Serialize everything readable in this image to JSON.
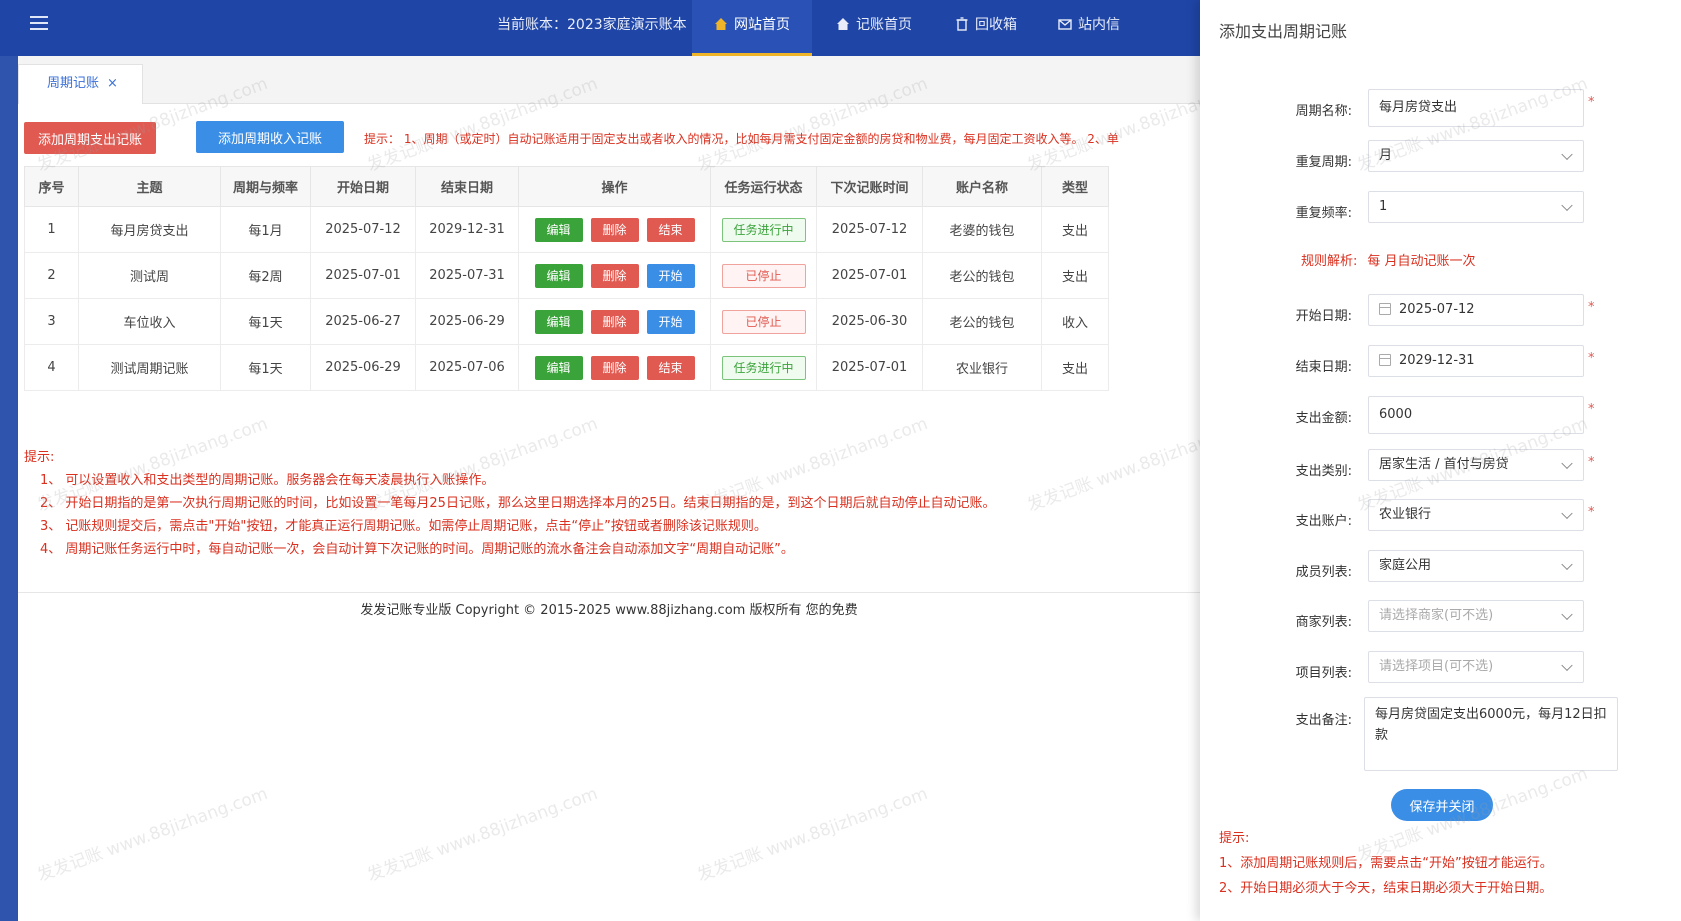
{
  "header": {
    "current_account": "当前账本：2023家庭演示账本",
    "nav": [
      {
        "label": "网站首页",
        "active": true
      },
      {
        "label": "记账首页",
        "active": false
      },
      {
        "label": "回收箱",
        "active": false
      },
      {
        "label": "站内信",
        "active": false
      }
    ]
  },
  "tab": {
    "label": "周期记账",
    "close": "×"
  },
  "toolbar": {
    "add_expense": "添加周期支出记账",
    "add_income": "添加周期收入记账",
    "tip": "提示：  1、周期（或定时）自动记账适用于固定支出或者收入的情况，比如每月需支付固定金额的房贷和物业费，每月固定工资收入等。   2、单"
  },
  "table": {
    "columns": [
      "序号",
      "主题",
      "周期与频率",
      "开始日期",
      "结束日期",
      "操作",
      "任务运行状态",
      "下次记账时间",
      "账户名称",
      "类型"
    ],
    "rows": [
      {
        "no": "1",
        "subject": "每月房贷支出",
        "freq": "每1月",
        "start": "2025-07-12",
        "end": "2029-12-31",
        "ops": [
          "编辑",
          "删除",
          "结束"
        ],
        "status": "任务进行中",
        "next": "2025-07-12",
        "account": "老婆的钱包",
        "type": "支出"
      },
      {
        "no": "2",
        "subject": "测试周",
        "freq": "每2周",
        "start": "2025-07-01",
        "end": "2025-07-31",
        "ops": [
          "编辑",
          "删除",
          "开始"
        ],
        "status": "已停止",
        "next": "2025-07-01",
        "account": "老公的钱包",
        "type": "支出"
      },
      {
        "no": "3",
        "subject": "车位收入",
        "freq": "每1天",
        "start": "2025-06-27",
        "end": "2025-06-29",
        "ops": [
          "编辑",
          "删除",
          "开始"
        ],
        "status": "已停止",
        "next": "2025-06-30",
        "account": "老公的钱包",
        "type": "收入"
      },
      {
        "no": "4",
        "subject": "测试周期记账",
        "freq": "每1天",
        "start": "2025-06-29",
        "end": "2025-07-06",
        "ops": [
          "编辑",
          "删除",
          "结束"
        ],
        "status": "任务进行中",
        "next": "2025-07-01",
        "account": "农业银行",
        "type": "支出"
      }
    ]
  },
  "notes": {
    "title": "提示:",
    "items": [
      "1、  可以设置收入和支出类型的周期记账。服务器会在每天凌晨执行入账操作。",
      "2、  开始日期指的是第一次执行周期记账的时间，比如设置一笔每月25日记账，那么这里日期选择本月的25日。结束日期指的是，到这个日期后就自动停止自动记账。",
      "3、  记账规则提交后，需点击\"开始\"按钮，才能真正运行周期记账。如需停止周期记账，点击“停止”按钮或者删除该记账规则。",
      "4、  周期记账任务运行中时，每自动记账一次，会自动计算下次记账的时间。周期记账的流水备注会自动添加文字“周期自动记账”。"
    ]
  },
  "footer": "发发记账专业版  Copyright © 2015-2025 www.88jizhang.com 版权所有    您的免费",
  "drawer": {
    "title": "添加支出周期记账",
    "fields": {
      "name": {
        "label": "周期名称:",
        "value": "每月房贷支出"
      },
      "repeat_period": {
        "label": "重复周期:",
        "value": "月"
      },
      "repeat_freq": {
        "label": "重复频率:",
        "value": "1"
      },
      "rule": {
        "label": "规则解析:",
        "value": "每 月自动记账一次"
      },
      "start_date": {
        "label": "开始日期:",
        "value": "2025-07-12"
      },
      "end_date": {
        "label": "结束日期:",
        "value": "2029-12-31"
      },
      "amount": {
        "label": "支出金额:",
        "value": "6000"
      },
      "category": {
        "label": "支出类别:",
        "value": "居家生活 / 首付与房贷"
      },
      "account": {
        "label": "支出账户:",
        "value": "农业银行"
      },
      "member": {
        "label": "成员列表:",
        "value": "家庭公用"
      },
      "merchant": {
        "label": "商家列表:",
        "placeholder": "请选择商家(可不选)"
      },
      "project": {
        "label": "项目列表:",
        "placeholder": "请选择项目(可不选)"
      },
      "memo": {
        "label": "支出备注:",
        "value": "每月房贷固定支出6000元，每月12日扣款"
      }
    },
    "save": "保存并关闭",
    "notes": {
      "title": "提示:",
      "items": [
        "1、添加周期记账规则后，需要点击“开始”按钮才能运行。",
        "2、开始日期必须大于今天，结束日期必须大于开始日期。"
      ]
    }
  },
  "colors": {
    "header": "#1f45a6",
    "primary": "#3a8ee6",
    "danger": "#e05a52",
    "success": "#3aa33a",
    "highlight": "#f0b429"
  }
}
